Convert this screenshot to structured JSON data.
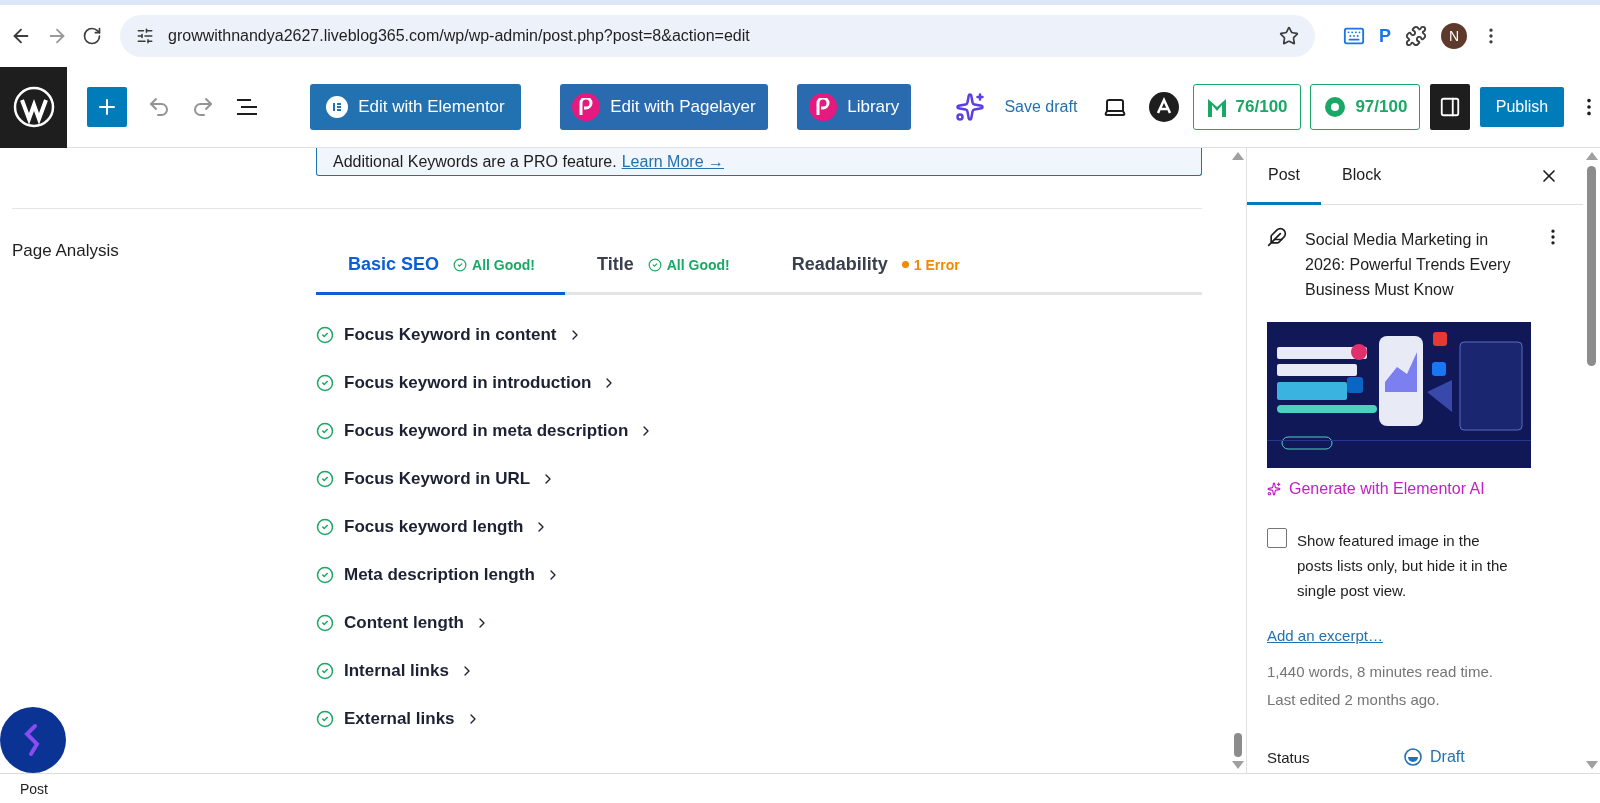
{
  "browser": {
    "url": "growwithnandya2627.liveblog365.com/wp/wp-admin/post.php?post=8&action=edit",
    "extension_letter": "P",
    "profile_initial": "N"
  },
  "toolbar": {
    "elementor_button": "Edit with Elementor",
    "pagelayer_button": "Edit with Pagelayer",
    "library_button": "Library",
    "save_draft": "Save draft",
    "scores": [
      {
        "value": "76/100",
        "kind": "m"
      },
      {
        "value": "97/100",
        "kind": "gear"
      }
    ],
    "publish_button": "Publish"
  },
  "notice": {
    "text": "Additional Keywords are a PRO feature.",
    "link": "Learn More →"
  },
  "analysis": {
    "heading": "Page Analysis",
    "tabs": [
      {
        "label": "Basic SEO",
        "status": "All Good!",
        "kind": "ok",
        "selected": true
      },
      {
        "label": "Title",
        "status": "All Good!",
        "kind": "ok",
        "selected": false
      },
      {
        "label": "Readability",
        "status": "1 Error",
        "kind": "error",
        "selected": false
      }
    ],
    "checks": [
      {
        "label": "Focus Keyword in content",
        "passed": true
      },
      {
        "label": "Focus keyword in introduction",
        "passed": true
      },
      {
        "label": "Focus keyword in meta description",
        "passed": true
      },
      {
        "label": "Focus Keyword in URL",
        "passed": true
      },
      {
        "label": "Focus keyword length",
        "passed": true
      },
      {
        "label": "Meta description length",
        "passed": true
      },
      {
        "label": "Content length",
        "passed": true
      },
      {
        "label": "Internal links",
        "passed": true
      },
      {
        "label": "External links",
        "passed": true
      }
    ]
  },
  "sidebar": {
    "tabs": [
      {
        "label": "Post",
        "selected": true
      },
      {
        "label": "Block",
        "selected": false
      }
    ],
    "post_title": "Social Media Marketing in 2026: Powerful Trends Every Business Must Know",
    "featured_image": {
      "kind": "picture"
    },
    "ai_link": "Generate with Elementor AI",
    "featured_checkbox": {
      "label": "Show featured image in the posts lists only, but hide it in the single post view.",
      "checked": false
    },
    "excerpt_link": "Add an excerpt…",
    "stats": [
      "1,440 words, 8 minutes read time.",
      "Last edited 2 months ago."
    ],
    "status": {
      "label": "Status",
      "value": "Draft"
    }
  },
  "footer": {
    "breadcrumb": "Post"
  }
}
